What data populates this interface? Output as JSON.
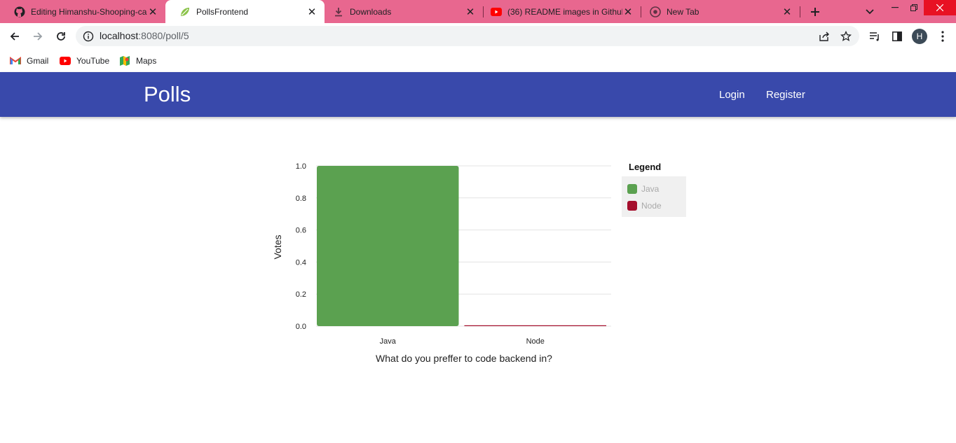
{
  "browser": {
    "tabs": [
      {
        "title": "Editing Himanshu-Shooping-cart",
        "icon": "github-icon",
        "active": false
      },
      {
        "title": "PollsFrontend",
        "icon": "leaf-icon",
        "active": true
      },
      {
        "title": "Downloads",
        "icon": "download-icon",
        "active": false
      },
      {
        "title": "(36) README images in Github",
        "icon": "youtube-icon",
        "active": false
      },
      {
        "title": "New Tab",
        "icon": "chrome-icon",
        "active": false
      }
    ],
    "url_host": "localhost",
    "url_path": ":8080/poll/5",
    "profile_initial": "H",
    "bookmarks": [
      {
        "label": "Gmail",
        "icon": "gmail-icon"
      },
      {
        "label": "YouTube",
        "icon": "youtube-icon"
      },
      {
        "label": "Maps",
        "icon": "maps-icon"
      }
    ]
  },
  "app": {
    "brand": "Polls",
    "nav": {
      "login": "Login",
      "register": "Register"
    },
    "colors": {
      "header": "#3949ab"
    }
  },
  "chart_data": {
    "type": "bar",
    "categories": [
      "Java",
      "Node"
    ],
    "values": [
      1,
      0
    ],
    "colors": [
      "#5ba150",
      "#a50f2d"
    ],
    "ylabel": "Votes",
    "xlabel": "What do you preffer to code backend in?",
    "ylim": [
      0,
      1
    ],
    "yticks": [
      "0.0",
      "0.2",
      "0.4",
      "0.6",
      "0.8",
      "1.0"
    ],
    "grid": true,
    "legend": {
      "title": "Legend",
      "placement": "top-right",
      "items": [
        "Java",
        "Node"
      ]
    }
  }
}
